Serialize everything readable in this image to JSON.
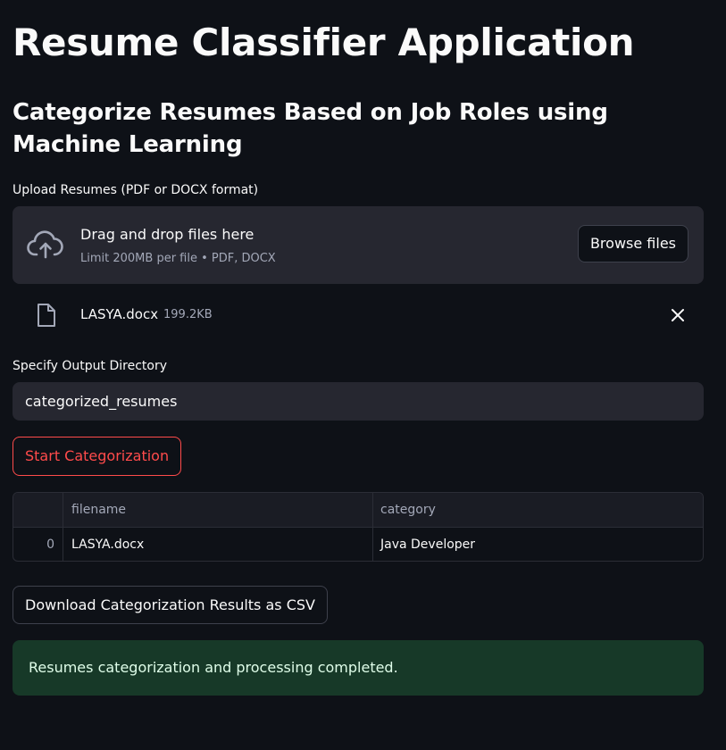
{
  "page": {
    "title": "Resume Classifier Application",
    "subtitle": "Categorize Resumes Based on Job Roles using Machine Learning"
  },
  "uploader": {
    "label": "Upload Resumes (PDF or DOCX format)",
    "drop_title": "Drag and drop files here",
    "drop_subtitle": "Limit 200MB per file • PDF, DOCX",
    "browse_label": "Browse files",
    "icon": "cloud-upload-icon"
  },
  "uploaded_file": {
    "name": "LASYA.docx",
    "size": "199.2KB",
    "icon": "file-icon",
    "remove_icon": "close-icon"
  },
  "output_dir": {
    "label": "Specify Output Directory",
    "value": "categorized_resumes"
  },
  "start_button": {
    "label": "Start Categorization"
  },
  "results_table": {
    "columns": [
      "",
      "filename",
      "category"
    ],
    "rows": [
      {
        "index": "0",
        "filename": "LASYA.docx",
        "category": "Java Developer"
      }
    ]
  },
  "download_button": {
    "label": "Download Categorization Results as CSV"
  },
  "status": {
    "message": "Resumes categorization and processing completed."
  },
  "colors": {
    "background": "#0e1117",
    "surface": "#262730",
    "primary": "#ff4b4b",
    "success_bg": "#173928",
    "success_text": "#dffde9",
    "muted_text": "#a3a8b8"
  }
}
